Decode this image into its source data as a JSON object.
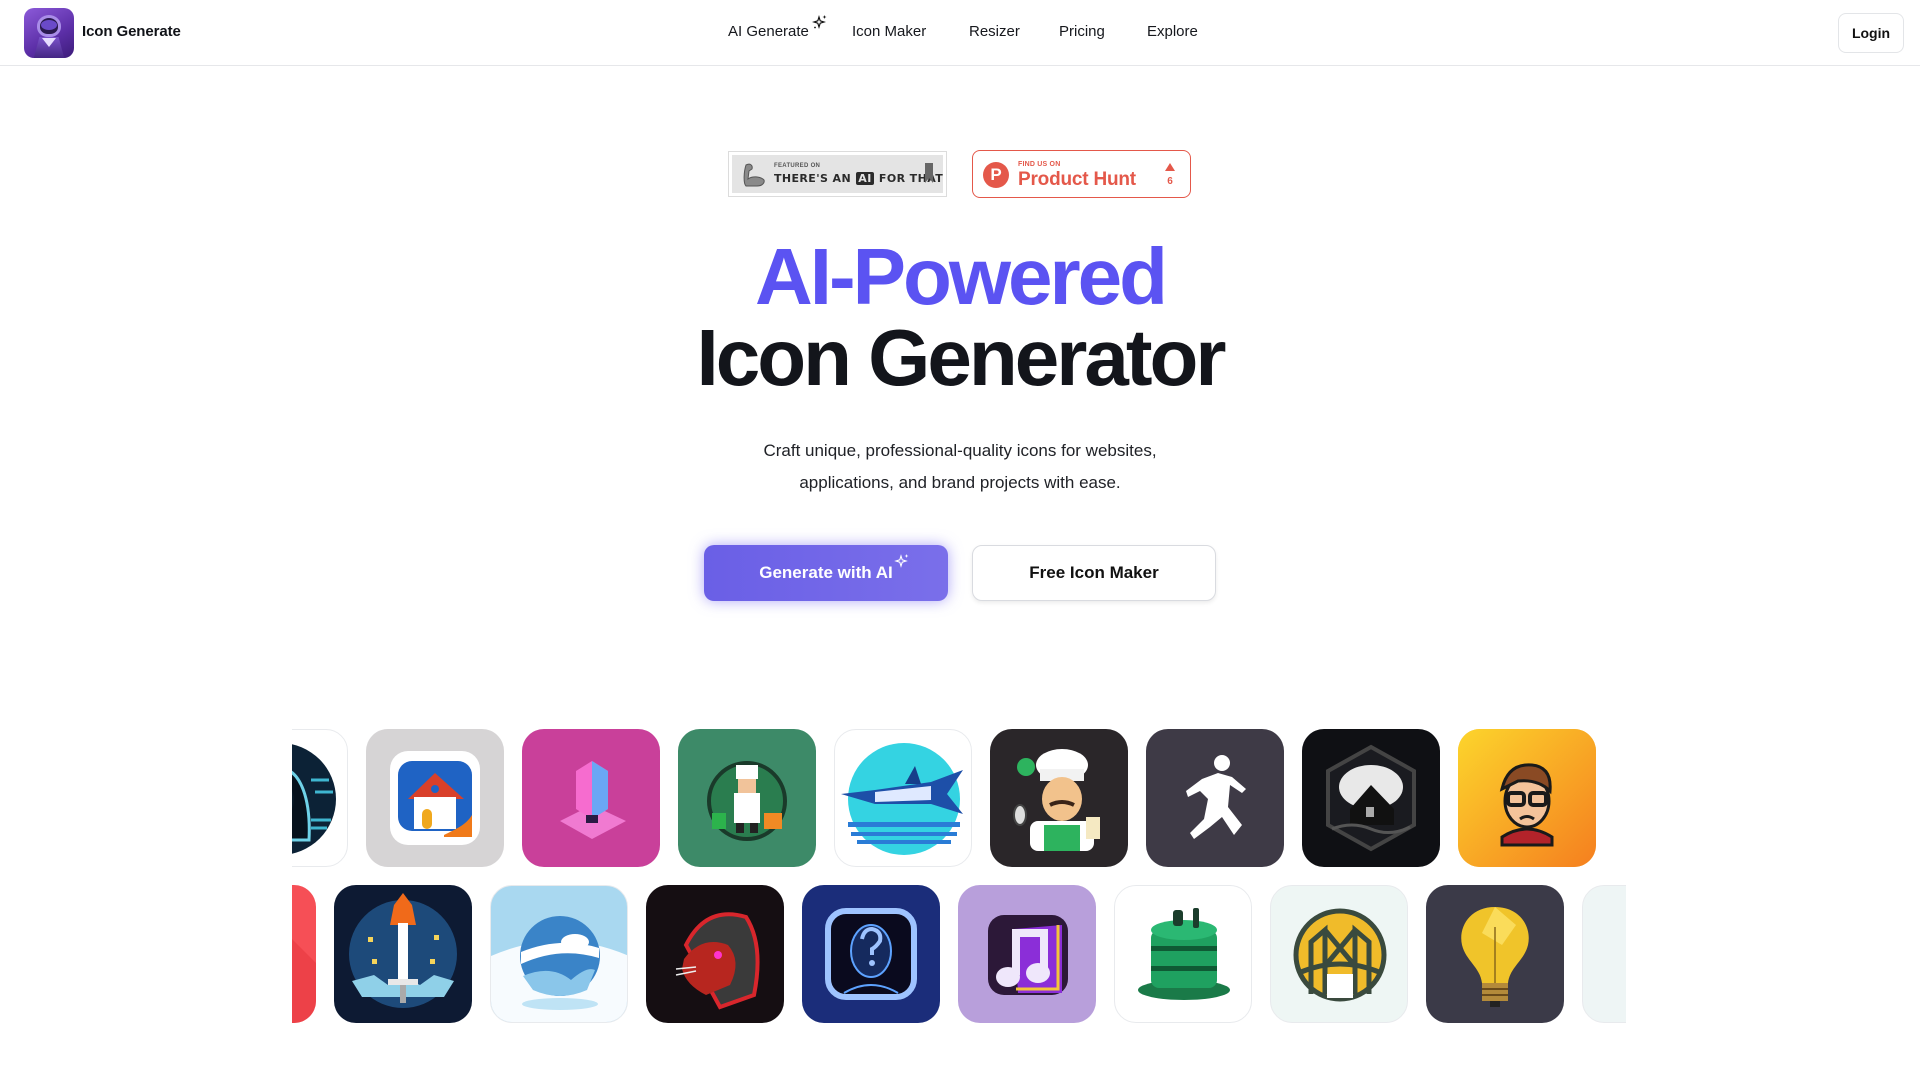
{
  "header": {
    "brand": "Icon Generate",
    "nav": [
      {
        "label": "AI Generate",
        "has_sparkle": true
      },
      {
        "label": "Icon Maker"
      },
      {
        "label": "Resizer"
      },
      {
        "label": "Pricing"
      },
      {
        "label": "Explore"
      }
    ],
    "login_label": "Login"
  },
  "badges": {
    "taaft": {
      "small": "FEATURED ON",
      "big_pre": "THERE'S AN",
      "big_ai": "AI",
      "big_post": "FOR THAT"
    },
    "product_hunt": {
      "small": "FIND US ON",
      "big": "Product Hunt",
      "logo_letter": "P",
      "upvotes": "6"
    }
  },
  "hero": {
    "line1": "AI-Powered",
    "line2": "Icon Generator",
    "subtitle_line1": "Craft unique, professional-quality icons for websites,",
    "subtitle_line2": "applications, and brand projects with ease.",
    "primary_cta": "Generate with AI",
    "secondary_cta": "Free Icon Maker"
  },
  "colors": {
    "accent": "#5b53f2",
    "product_hunt": "#e4584a",
    "text": "#13151b"
  },
  "gallery": {
    "row1": [
      {
        "name": "hooded-hacker-icon",
        "bg": "#ffffff"
      },
      {
        "name": "house-icon",
        "bg": "#d6d4d5"
      },
      {
        "name": "pink-cube-icon",
        "bg": "#c9409a"
      },
      {
        "name": "chef-pixel-icon",
        "bg": "#3d8a68"
      },
      {
        "name": "swordfish-pixel-icon",
        "bg": "#ffffff"
      },
      {
        "name": "chef-cartoon-icon",
        "bg": "#2a2629"
      },
      {
        "name": "runner-icon",
        "bg": "#3e3a46"
      },
      {
        "name": "haunted-house-icon",
        "bg": "#0f1014"
      },
      {
        "name": "nerd-boy-icon",
        "bg": "#f9b526"
      }
    ],
    "row2": [
      {
        "name": "red-phone-icon",
        "bg": "#f64f56"
      },
      {
        "name": "pixel-sword-icon",
        "bg": "#0d1a33"
      },
      {
        "name": "cloud-globe-icon",
        "bg": "#a9d8f0"
      },
      {
        "name": "hooded-beaver-icon",
        "bg": "#150e12"
      },
      {
        "name": "ai-head-question-icon",
        "bg": "#1b2d7a"
      },
      {
        "name": "music-note-icon",
        "bg": "#b89fdb"
      },
      {
        "name": "green-barrel-icon",
        "bg": "#ffffff"
      },
      {
        "name": "bridge-icon",
        "bg": "#eef6f4"
      },
      {
        "name": "lightbulb-icon",
        "bg": "#3b3a48"
      },
      {
        "name": "partial-light-icon",
        "bg": "#eef5f5"
      }
    ]
  }
}
